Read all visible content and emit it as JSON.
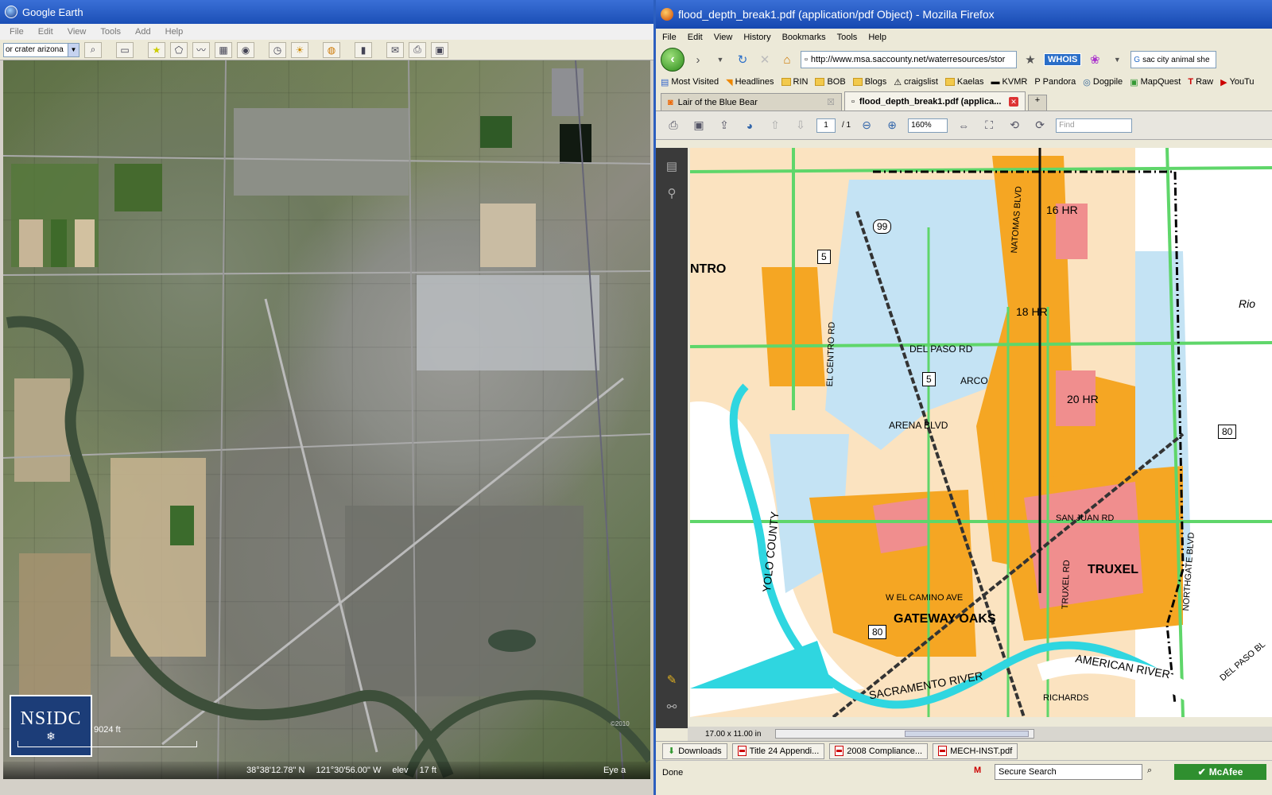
{
  "google_earth": {
    "title": "Google Earth",
    "menu": [
      "File",
      "Edit",
      "View",
      "Tools",
      "Add",
      "Help"
    ],
    "search_value": "or crater arizona",
    "status": {
      "scale": "9024 ft",
      "lat": "38°38'12.78\" N",
      "lon": "121°30'56.00\" W",
      "elev_label": "elev",
      "elev": "17 ft",
      "eye": "Eye a",
      "copyright": "©2010"
    },
    "logo_text": "NSIDC"
  },
  "firefox": {
    "title": "flood_depth_break1.pdf (application/pdf Object) - Mozilla Firefox",
    "menu": [
      "File",
      "Edit",
      "View",
      "History",
      "Bookmarks",
      "Tools",
      "Help"
    ],
    "url": "http://www.msa.saccounty.net/waterresources/stor",
    "whois": "WHOIS",
    "search_value": "sac city animal she",
    "bookmarks": [
      "Most Visited",
      "Headlines",
      "RIN",
      "BOB",
      "Blogs",
      "craigslist",
      "Kaelas",
      "KVMR",
      "Pandora",
      "Dogpile",
      "MapQuest",
      "Raw",
      "YouTu"
    ],
    "tabs": [
      {
        "label": "Lair of the Blue Bear"
      },
      {
        "label": "flood_depth_break1.pdf (applica..."
      }
    ],
    "pdf": {
      "page_current": "1",
      "page_total": "/ 1",
      "zoom": "160%",
      "find_placeholder": "Find",
      "page_size": "17.00 x 11.00 in"
    },
    "map_labels": {
      "hr16": "16 HR",
      "hr18": "18 HR",
      "hr20": "20 HR",
      "ntro": "NTRO",
      "del_paso": "DEL PASO RD",
      "el_centro": "EL CENTRO RD",
      "arena": "ARENA BLVD",
      "san_juan": "SAN JUAN RD",
      "truxel": "TRUXEL",
      "truxel_rd": "TRUXEL RD",
      "northgate": "NORTHGATE BLVD",
      "gateway": "GATEWAY OAKS",
      "el_camino": "W EL CAMINO AVE",
      "yolo": "YOLO COUNTY",
      "sac_river": "SACRAMENTO RIVER",
      "american_river": "AMERICAN RIVER",
      "richards": "RICHARDS",
      "natomas": "NATOMAS BLVD",
      "rio": "Rio",
      "del_paso_blvd": "DEL PASO BL",
      "arco": "ARCO",
      "s99": "99",
      "i5a": "5",
      "i5b": "5",
      "i80a": "80",
      "i80b": "80"
    },
    "downloads": [
      "Downloads",
      "Title 24 Appendi...",
      "2008 Compliance...",
      "MECH-INST.pdf"
    ],
    "status": "Done",
    "secure_search": "Secure Search",
    "mcafee": "McAfee"
  }
}
